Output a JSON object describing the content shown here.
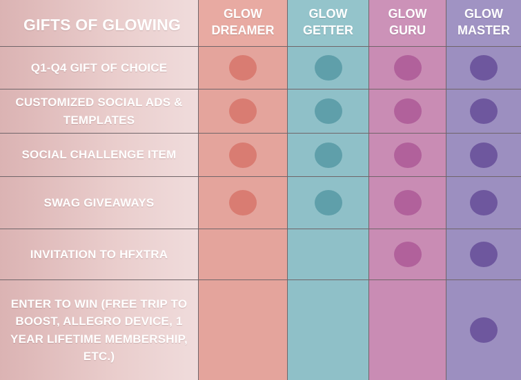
{
  "title": "GIFTS OF GLOWING",
  "tiers": [
    {
      "key": "dreamer",
      "label": "GLOW DREAMER",
      "line1": "GLOW",
      "line2": "DREAMER",
      "color": "#e4a49c",
      "dot_color": "#d97c72"
    },
    {
      "key": "getter",
      "label": "GLOW GETTER",
      "line1": "GLOW",
      "line2": "GETTER",
      "color": "#8fc0c8",
      "dot_color": "#5f9faa"
    },
    {
      "key": "guru",
      "label": "GLOW GURU",
      "line1": "GLOW",
      "line2": "GURU",
      "color": "#c98cb4",
      "dot_color": "#b1619b"
    },
    {
      "key": "master",
      "label": "GLOW MASTER",
      "line1": "GLOW",
      "line2": "MASTER",
      "color": "#9c8fc0",
      "dot_color": "#6e579e"
    }
  ],
  "rows": [
    {
      "label": "Q1-Q4 GIFT OF CHOICE",
      "included": [
        true,
        true,
        true,
        true
      ]
    },
    {
      "label": "CUSTOMIZED SOCIAL ADS & TEMPLATES",
      "included": [
        true,
        true,
        true,
        true
      ]
    },
    {
      "label": "SOCIAL CHALLENGE ITEM",
      "included": [
        true,
        true,
        true,
        true
      ]
    },
    {
      "label": "SWAG GIVEAWAYS",
      "included": [
        true,
        true,
        true,
        true
      ]
    },
    {
      "label": "INVITATION TO HFXTRA",
      "included": [
        false,
        false,
        true,
        true
      ]
    },
    {
      "label": "ENTER TO WIN (FREE TRIP TO BOOST, ALLEGRO DEVICE, 1 YEAR LIFETIME MEMBERSHIP, ETC.)",
      "included": [
        false,
        false,
        false,
        true
      ]
    }
  ]
}
